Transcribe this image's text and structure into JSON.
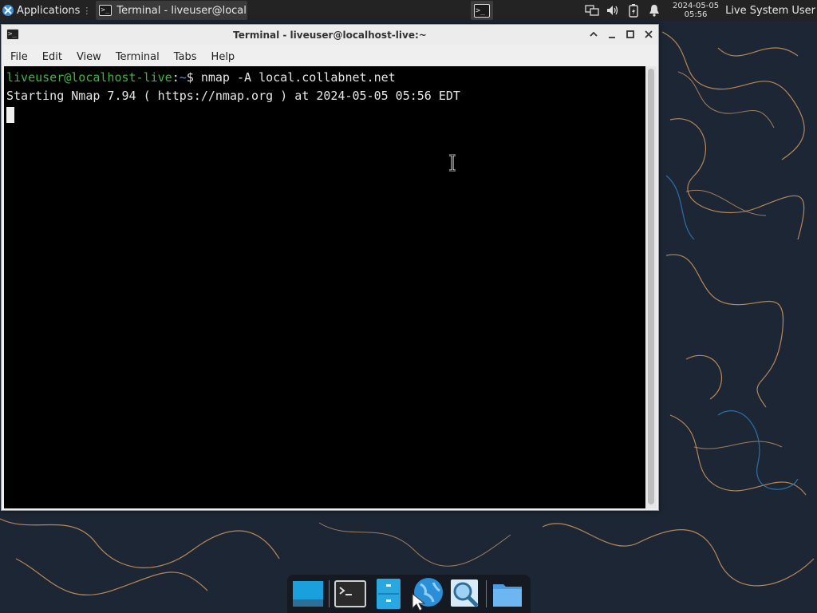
{
  "top_panel": {
    "applications_label": "Applications",
    "task_label": "Terminal - liveuser@localh...",
    "clock_date": "2024-05-05",
    "clock_time": "05:56",
    "user_label": "Live System User"
  },
  "window": {
    "title": "Terminal - liveuser@localhost-live:~",
    "menu": [
      "File",
      "Edit",
      "View",
      "Terminal",
      "Tabs",
      "Help"
    ]
  },
  "terminal": {
    "prompt_user": "liveuser@localhost-live",
    "prompt_sep": ":",
    "prompt_dir": "~",
    "prompt_symbol": "$ ",
    "command": "nmap -A local.collabnet.net",
    "output_line_1": "Starting Nmap 7.94 ( https://nmap.org ) at 2024-05-05 05:56 EDT"
  },
  "dock": {
    "items": [
      "show-desktop-icon",
      "terminal-icon",
      "file-cabinet-icon",
      "web-browser-icon",
      "search-icon",
      "folder-icon"
    ]
  },
  "colors": {
    "prompt_user": "#3fb83f",
    "prompt_dir": "#5b8fe0",
    "terminal_bg": "#000000",
    "panel_bg": "#232323"
  }
}
